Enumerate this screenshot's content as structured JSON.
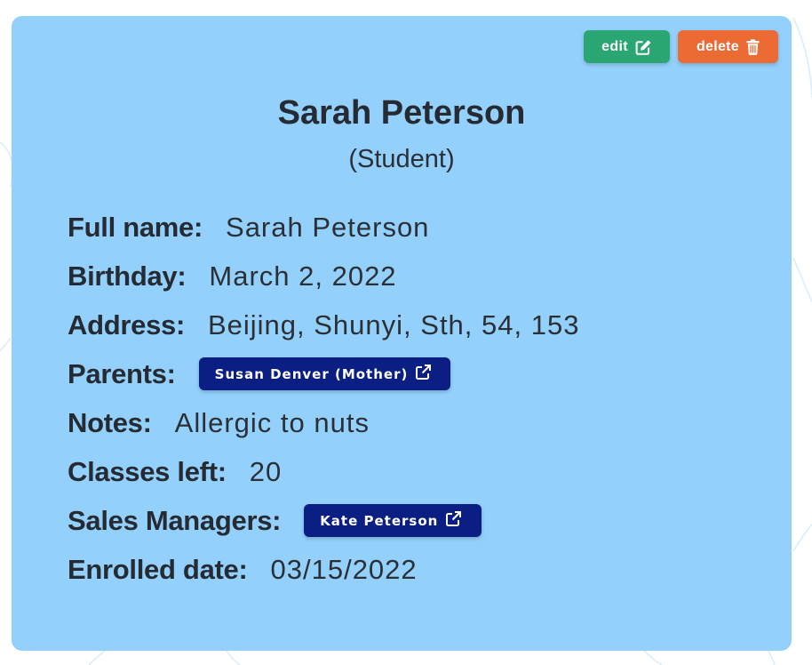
{
  "card": {
    "actions": {
      "edit_label": "edit",
      "delete_label": "delete"
    },
    "name": "Sarah Peterson",
    "role": "(Student)",
    "fields": {
      "full_name": {
        "label": "Full name:",
        "value": "Sarah Peterson"
      },
      "birthday": {
        "label": "Birthday:",
        "value": "March 2, 2022"
      },
      "address": {
        "label": "Address:",
        "value": "Beijing, Shunyi, Sth, 54, 153"
      },
      "parents": {
        "label": "Parents:",
        "link": "Susan Denver (Mother)"
      },
      "notes": {
        "label": "Notes:",
        "value": "Allergic to nuts"
      },
      "classes_left": {
        "label": "Classes left:",
        "value": "20"
      },
      "sales_managers": {
        "label": "Sales Managers:",
        "link": "Kate Peterson"
      },
      "enrolled_date": {
        "label": "Enrolled date:",
        "value": "03/15/2022"
      }
    }
  },
  "colors": {
    "card_bg": "#93d0fb",
    "edit": "#2aa673",
    "delete": "#ec6a34",
    "chip": "#0b1e84"
  },
  "icons": {
    "edit": "edit-icon",
    "delete": "trash-icon",
    "external_link": "external-link-icon"
  }
}
